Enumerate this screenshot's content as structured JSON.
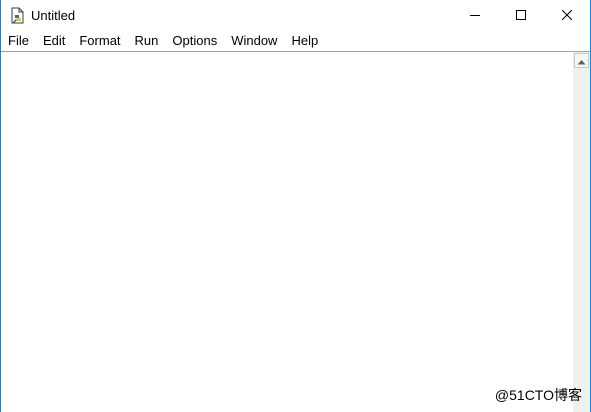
{
  "window": {
    "title": "Untitled",
    "app_icon": "python-idle-document-icon",
    "controls": {
      "minimize_icon": "minimize-icon",
      "maximize_icon": "maximize-icon",
      "close_icon": "close-icon"
    }
  },
  "menubar": {
    "items": [
      {
        "label": "File"
      },
      {
        "label": "Edit"
      },
      {
        "label": "Format"
      },
      {
        "label": "Run"
      },
      {
        "label": "Options"
      },
      {
        "label": "Window"
      },
      {
        "label": "Help"
      }
    ]
  },
  "editor": {
    "content": ""
  },
  "scrollbar": {
    "up_icon": "scroll-up-arrow-icon"
  },
  "watermark": {
    "text": "@51CTO博客"
  },
  "colors": {
    "window_border": "#1883d7",
    "divider": "#a0a0a0",
    "scrollbar_bg": "#f0f0f0"
  }
}
